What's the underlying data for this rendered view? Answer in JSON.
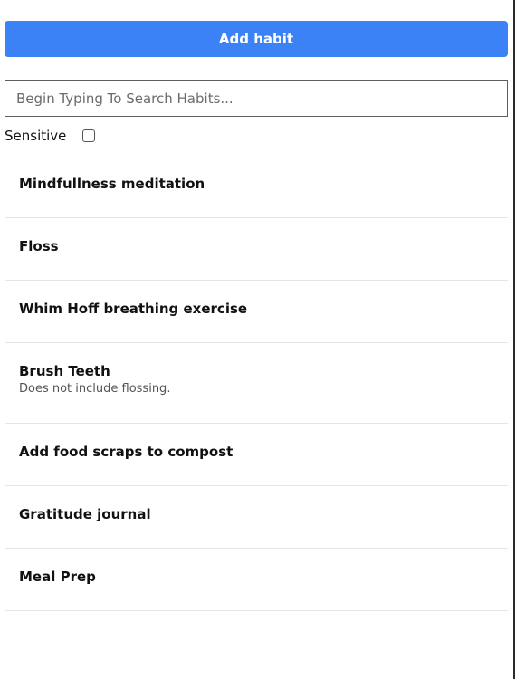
{
  "toolbar": {
    "add_label": "Add habit"
  },
  "search": {
    "placeholder": "Begin Typing To Search Habits...",
    "value": ""
  },
  "filter": {
    "sensitive_label": "Sensitive",
    "sensitive_checked": false
  },
  "habits": [
    {
      "title": "Mindfullness meditation",
      "description": ""
    },
    {
      "title": "Floss",
      "description": ""
    },
    {
      "title": "Whim Hoff breathing exercise",
      "description": ""
    },
    {
      "title": "Brush Teeth",
      "description": "Does not include flossing."
    },
    {
      "title": "Add food scraps to compost",
      "description": ""
    },
    {
      "title": "Gratitude journal",
      "description": ""
    },
    {
      "title": "Meal Prep",
      "description": ""
    }
  ],
  "colors": {
    "accent": "#3b82f6"
  }
}
